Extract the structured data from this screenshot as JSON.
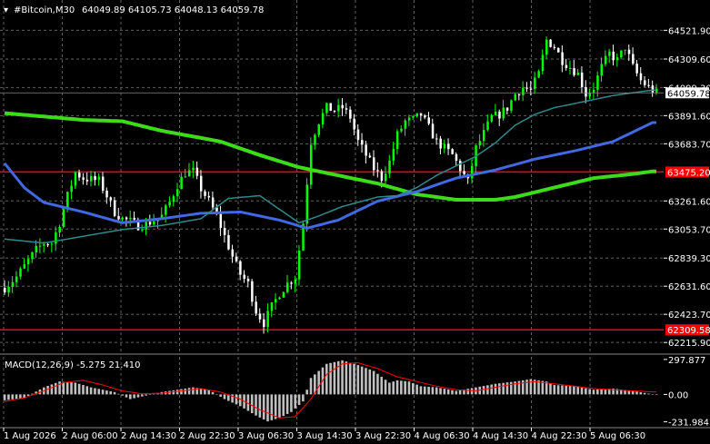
{
  "header": {
    "title": "#Bitcoin,M30",
    "ohlc": "64049.89 64105.73 64048.13 64059.78"
  },
  "colors": {
    "background": "#000000",
    "grid": "#5f5f5f",
    "bull": "#00ff00",
    "bear": "#ffffff",
    "ma_fast": "#2e8b8b",
    "ma_mid": "#4169e1",
    "ma_slow": "#3ddc1a",
    "level": "#ff0000",
    "macd_hist": "#c0c0c0",
    "macd_signal": "#ff0000",
    "price_tag": "#ffffff"
  },
  "chart_data": [
    {
      "type": "line",
      "ylim": [
        62150,
        64625
      ],
      "yticks": [
        "64521.90",
        "64309.60",
        "64099.30",
        "63891.60",
        "63683.70",
        "63475.20",
        "63261.60",
        "63053.70",
        "62839.30",
        "62631.60",
        "62423.70",
        "62309.58",
        "62215.90"
      ],
      "xticks": [
        "1 Aug 2026",
        "2 Aug 06:00",
        "2 Aug 14:30",
        "2 Aug 22:30",
        "3 Aug 06:30",
        "3 Aug 14:30",
        "3 Aug 22:30",
        "4 Aug 06:30",
        "4 Aug 14:30",
        "4 Aug 22:30",
        "5 Aug 06:30"
      ],
      "current_price": "64059.78",
      "levels": [
        {
          "price": 63475.2,
          "label": "63475.20"
        },
        {
          "price": 62309.58,
          "label": "62309.58"
        }
      ],
      "price_anchors": [
        [
          0,
          62620
        ],
        [
          3,
          62700
        ],
        [
          6,
          62820
        ],
        [
          8,
          62900
        ],
        [
          10,
          62950
        ],
        [
          12,
          62950
        ],
        [
          14,
          63100
        ],
        [
          16,
          63300
        ],
        [
          18,
          63470
        ],
        [
          20,
          63430
        ],
        [
          22,
          63420
        ],
        [
          24,
          63410
        ],
        [
          26,
          63300
        ],
        [
          28,
          63180
        ],
        [
          30,
          63130
        ],
        [
          32,
          63110
        ],
        [
          34,
          63080
        ],
        [
          36,
          63090
        ],
        [
          38,
          63120
        ],
        [
          40,
          63150
        ],
        [
          42,
          63250
        ],
        [
          44,
          63380
        ],
        [
          46,
          63470
        ],
        [
          48,
          63480
        ],
        [
          50,
          63350
        ],
        [
          52,
          63260
        ],
        [
          54,
          63150
        ],
        [
          56,
          63000
        ],
        [
          58,
          62850
        ],
        [
          60,
          62720
        ],
        [
          62,
          62650
        ],
        [
          64,
          62450
        ],
        [
          66,
          62360
        ],
        [
          68,
          62480
        ],
        [
          70,
          62580
        ],
        [
          72,
          62650
        ],
        [
          74,
          62700
        ],
        [
          75,
          62900
        ],
        [
          76,
          63100
        ],
        [
          77,
          63400
        ],
        [
          78,
          63700
        ],
        [
          80,
          63850
        ],
        [
          82,
          63950
        ],
        [
          84,
          63930
        ],
        [
          86,
          63950
        ],
        [
          88,
          63880
        ],
        [
          90,
          63700
        ],
        [
          92,
          63600
        ],
        [
          94,
          63500
        ],
        [
          96,
          63430
        ],
        [
          98,
          63550
        ],
        [
          100,
          63750
        ],
        [
          102,
          63850
        ],
        [
          104,
          63860
        ],
        [
          106,
          63900
        ],
        [
          108,
          63800
        ],
        [
          110,
          63700
        ],
        [
          112,
          63650
        ],
        [
          114,
          63600
        ],
        [
          116,
          63500
        ],
        [
          118,
          63400
        ],
        [
          120,
          63650
        ],
        [
          122,
          63760
        ],
        [
          124,
          63880
        ],
        [
          126,
          63900
        ],
        [
          128,
          63950
        ],
        [
          130,
          64050
        ],
        [
          132,
          64100
        ],
        [
          134,
          64080
        ],
        [
          136,
          64200
        ],
        [
          138,
          64450
        ],
        [
          140,
          64400
        ],
        [
          142,
          64300
        ],
        [
          144,
          64250
        ],
        [
          146,
          64200
        ],
        [
          148,
          64050
        ],
        [
          150,
          64100
        ],
        [
          152,
          64250
        ],
        [
          154,
          64350
        ],
        [
          156,
          64300
        ],
        [
          158,
          64400
        ],
        [
          160,
          64250
        ],
        [
          162,
          64150
        ],
        [
          164,
          64100
        ],
        [
          166,
          64060
        ]
      ],
      "ma_fast": [
        [
          0,
          62980
        ],
        [
          10,
          62950
        ],
        [
          20,
          63000
        ],
        [
          30,
          63050
        ],
        [
          40,
          63080
        ],
        [
          50,
          63130
        ],
        [
          57,
          63280
        ],
        [
          65,
          63300
        ],
        [
          75,
          63100
        ],
        [
          80,
          63150
        ],
        [
          86,
          63220
        ],
        [
          95,
          63290
        ],
        [
          100,
          63300
        ],
        [
          105,
          63360
        ],
        [
          110,
          63450
        ],
        [
          115,
          63520
        ],
        [
          120,
          63590
        ],
        [
          125,
          63690
        ],
        [
          130,
          63820
        ],
        [
          135,
          63900
        ],
        [
          140,
          63950
        ],
        [
          145,
          63980
        ],
        [
          150,
          64010
        ],
        [
          155,
          64040
        ],
        [
          160,
          64060
        ],
        [
          165,
          64080
        ]
      ],
      "ma_mid": [
        [
          0,
          63540
        ],
        [
          5,
          63360
        ],
        [
          10,
          63250
        ],
        [
          20,
          63180
        ],
        [
          30,
          63100
        ],
        [
          40,
          63130
        ],
        [
          50,
          63170
        ],
        [
          60,
          63180
        ],
        [
          70,
          63120
        ],
        [
          77,
          63060
        ],
        [
          85,
          63120
        ],
        [
          95,
          63260
        ],
        [
          105,
          63330
        ],
        [
          115,
          63430
        ],
        [
          125,
          63490
        ],
        [
          135,
          63570
        ],
        [
          145,
          63630
        ],
        [
          155,
          63700
        ],
        [
          165,
          63840
        ]
      ],
      "ma_slow": [
        [
          0,
          63910
        ],
        [
          20,
          63860
        ],
        [
          30,
          63850
        ],
        [
          40,
          63780
        ],
        [
          55,
          63700
        ],
        [
          65,
          63600
        ],
        [
          75,
          63510
        ],
        [
          85,
          63450
        ],
        [
          95,
          63390
        ],
        [
          105,
          63310
        ],
        [
          115,
          63270
        ],
        [
          125,
          63270
        ],
        [
          130,
          63290
        ],
        [
          140,
          63360
        ],
        [
          150,
          63430
        ],
        [
          160,
          63460
        ],
        [
          165,
          63480
        ]
      ]
    },
    {
      "type": "bar",
      "title": "MACD(12,26,9) -5.275 21.410",
      "ylim": [
        -260,
        320
      ],
      "yticks": [
        "297.877",
        "0.00",
        "-231.984"
      ],
      "hist_anchors": [
        [
          0,
          -50
        ],
        [
          5,
          -30
        ],
        [
          10,
          60
        ],
        [
          14,
          110
        ],
        [
          18,
          100
        ],
        [
          22,
          60
        ],
        [
          28,
          20
        ],
        [
          32,
          -40
        ],
        [
          36,
          -10
        ],
        [
          40,
          20
        ],
        [
          44,
          40
        ],
        [
          48,
          60
        ],
        [
          52,
          40
        ],
        [
          56,
          -40
        ],
        [
          60,
          -100
        ],
        [
          64,
          -180
        ],
        [
          67,
          -230
        ],
        [
          70,
          -200
        ],
        [
          73,
          -150
        ],
        [
          76,
          -60
        ],
        [
          78,
          140
        ],
        [
          82,
          260
        ],
        [
          86,
          290
        ],
        [
          90,
          250
        ],
        [
          94,
          200
        ],
        [
          98,
          100
        ],
        [
          100,
          120
        ],
        [
          103,
          110
        ],
        [
          106,
          70
        ],
        [
          110,
          60
        ],
        [
          115,
          30
        ],
        [
          120,
          60
        ],
        [
          125,
          90
        ],
        [
          130,
          110
        ],
        [
          134,
          130
        ],
        [
          138,
          110
        ],
        [
          140,
          80
        ],
        [
          145,
          70
        ],
        [
          150,
          40
        ],
        [
          155,
          50
        ],
        [
          160,
          30
        ],
        [
          166,
          -5
        ]
      ],
      "signal_anchors": [
        [
          0,
          -60
        ],
        [
          5,
          -30
        ],
        [
          10,
          30
        ],
        [
          15,
          100
        ],
        [
          20,
          120
        ],
        [
          25,
          80
        ],
        [
          30,
          30
        ],
        [
          35,
          5
        ],
        [
          40,
          10
        ],
        [
          45,
          30
        ],
        [
          50,
          50
        ],
        [
          55,
          20
        ],
        [
          60,
          -40
        ],
        [
          65,
          -130
        ],
        [
          70,
          -200
        ],
        [
          74,
          -190
        ],
        [
          78,
          -40
        ],
        [
          82,
          170
        ],
        [
          86,
          260
        ],
        [
          90,
          270
        ],
        [
          95,
          220
        ],
        [
          100,
          150
        ],
        [
          105,
          110
        ],
        [
          110,
          70
        ],
        [
          115,
          40
        ],
        [
          120,
          30
        ],
        [
          125,
          60
        ],
        [
          130,
          90
        ],
        [
          135,
          110
        ],
        [
          140,
          90
        ],
        [
          145,
          70
        ],
        [
          150,
          50
        ],
        [
          155,
          40
        ],
        [
          160,
          30
        ],
        [
          166,
          20
        ]
      ]
    }
  ]
}
